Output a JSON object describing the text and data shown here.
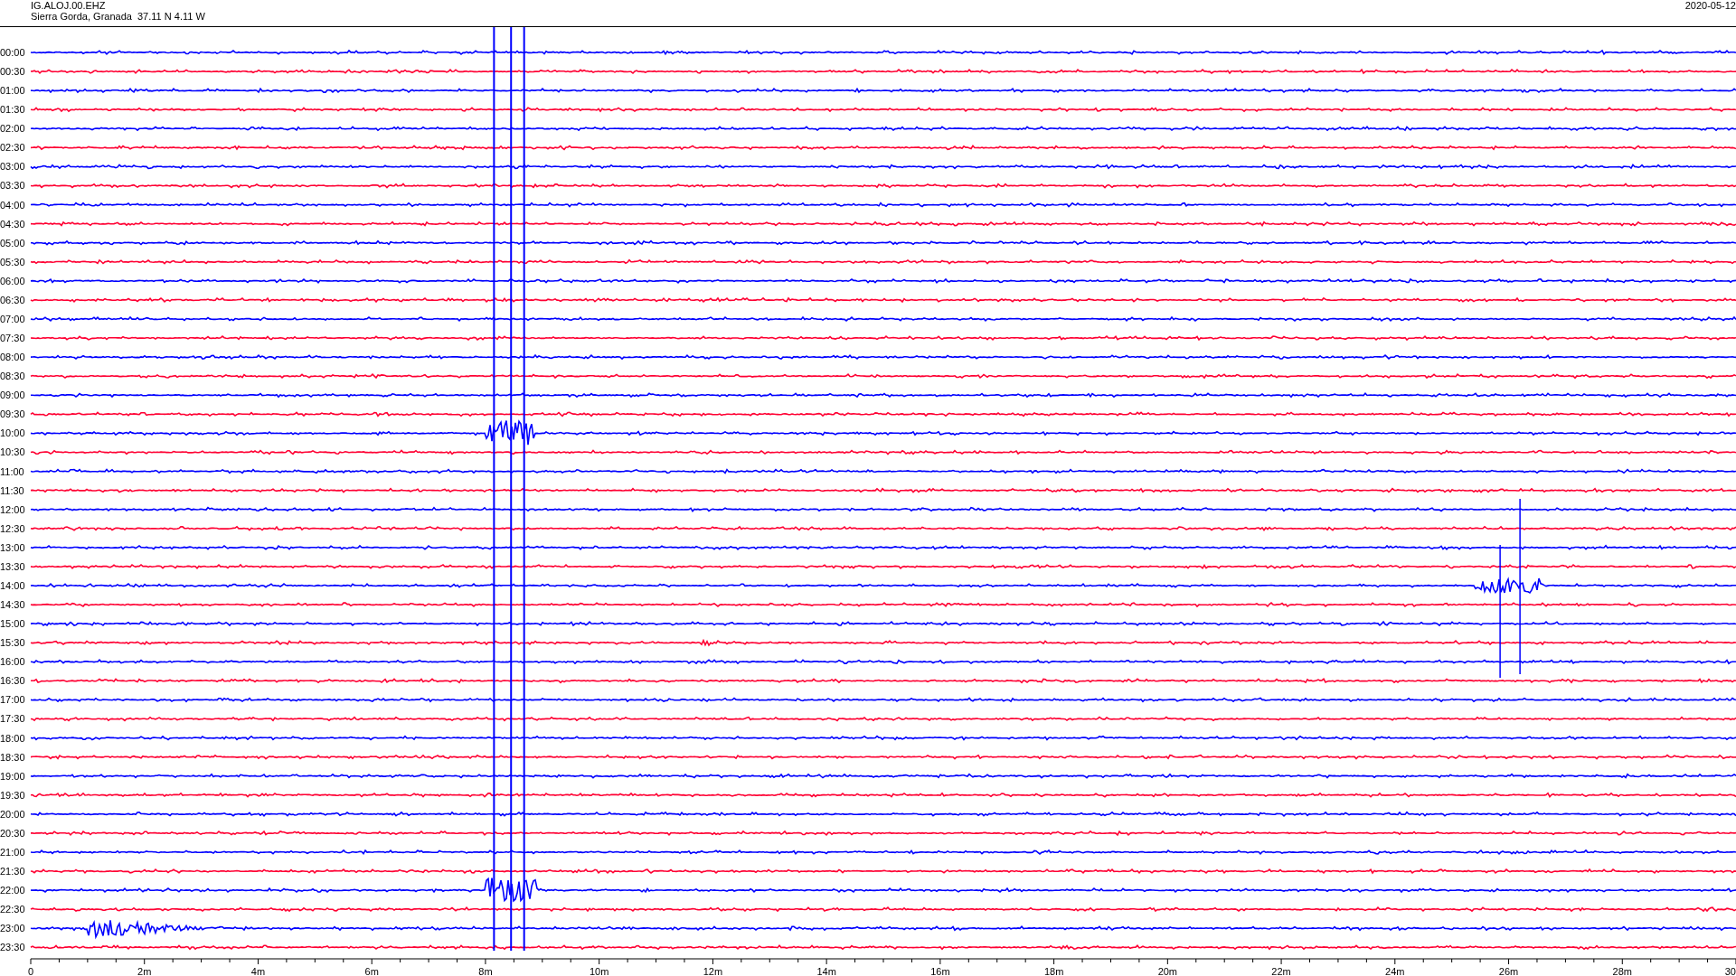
{
  "header": {
    "station": "IG.ALOJ.00.EHZ",
    "location": "Sierra Gorda, Granada  37.11 N 4.11 W",
    "date": "2020-05-12"
  },
  "traces": [
    {
      "label": "00:00",
      "color": "#0000ff"
    },
    {
      "label": "00:30",
      "color": "#ff0033"
    },
    {
      "label": "01:00",
      "color": "#0000ff"
    },
    {
      "label": "01:30",
      "color": "#ff0033"
    },
    {
      "label": "02:00",
      "color": "#0000ff"
    },
    {
      "label": "02:30",
      "color": "#ff0033"
    },
    {
      "label": "03:00",
      "color": "#0000ff"
    },
    {
      "label": "03:30",
      "color": "#ff0033"
    },
    {
      "label": "04:00",
      "color": "#0000ff"
    },
    {
      "label": "04:30",
      "color": "#ff0033"
    },
    {
      "label": "05:00",
      "color": "#0000ff"
    },
    {
      "label": "05:30",
      "color": "#ff0033"
    },
    {
      "label": "06:00",
      "color": "#0000ff"
    },
    {
      "label": "06:30",
      "color": "#ff0033"
    },
    {
      "label": "07:00",
      "color": "#0000ff"
    },
    {
      "label": "07:30",
      "color": "#ff0033"
    },
    {
      "label": "08:00",
      "color": "#0000ff"
    },
    {
      "label": "08:30",
      "color": "#ff0033"
    },
    {
      "label": "09:00",
      "color": "#0000ff"
    },
    {
      "label": "09:30",
      "color": "#ff0033"
    },
    {
      "label": "10:00",
      "color": "#0000ff"
    },
    {
      "label": "10:30",
      "color": "#ff0033"
    },
    {
      "label": "11:00",
      "color": "#0000ff"
    },
    {
      "label": "11:30",
      "color": "#ff0033"
    },
    {
      "label": "12:00",
      "color": "#0000ff"
    },
    {
      "label": "12:30",
      "color": "#ff0033"
    },
    {
      "label": "13:00",
      "color": "#0000ff"
    },
    {
      "label": "13:30",
      "color": "#ff0033"
    },
    {
      "label": "14:00",
      "color": "#0000ff"
    },
    {
      "label": "14:30",
      "color": "#ff0033"
    },
    {
      "label": "15:00",
      "color": "#0000ff"
    },
    {
      "label": "15:30",
      "color": "#ff0033"
    },
    {
      "label": "16:00",
      "color": "#0000ff"
    },
    {
      "label": "16:30",
      "color": "#ff0033"
    },
    {
      "label": "17:00",
      "color": "#0000ff"
    },
    {
      "label": "17:30",
      "color": "#ff0033"
    },
    {
      "label": "18:00",
      "color": "#0000ff"
    },
    {
      "label": "18:30",
      "color": "#ff0033"
    },
    {
      "label": "19:00",
      "color": "#0000ff"
    },
    {
      "label": "19:30",
      "color": "#ff0033"
    },
    {
      "label": "20:00",
      "color": "#0000ff"
    },
    {
      "label": "20:30",
      "color": "#ff0033"
    },
    {
      "label": "21:00",
      "color": "#0000ff"
    },
    {
      "label": "21:30",
      "color": "#ff0033"
    },
    {
      "label": "22:00",
      "color": "#0000ff"
    },
    {
      "label": "22:30",
      "color": "#ff0033"
    },
    {
      "label": "23:00",
      "color": "#0000ff"
    },
    {
      "label": "23:30",
      "color": "#ff0033"
    }
  ],
  "x_axis": {
    "ticks": [
      "0",
      "2m",
      "4m",
      "6m",
      "8m",
      "10m",
      "12m",
      "14m",
      "16m",
      "18m",
      "20m",
      "22m",
      "24m",
      "26m",
      "28m",
      "30"
    ]
  }
}
